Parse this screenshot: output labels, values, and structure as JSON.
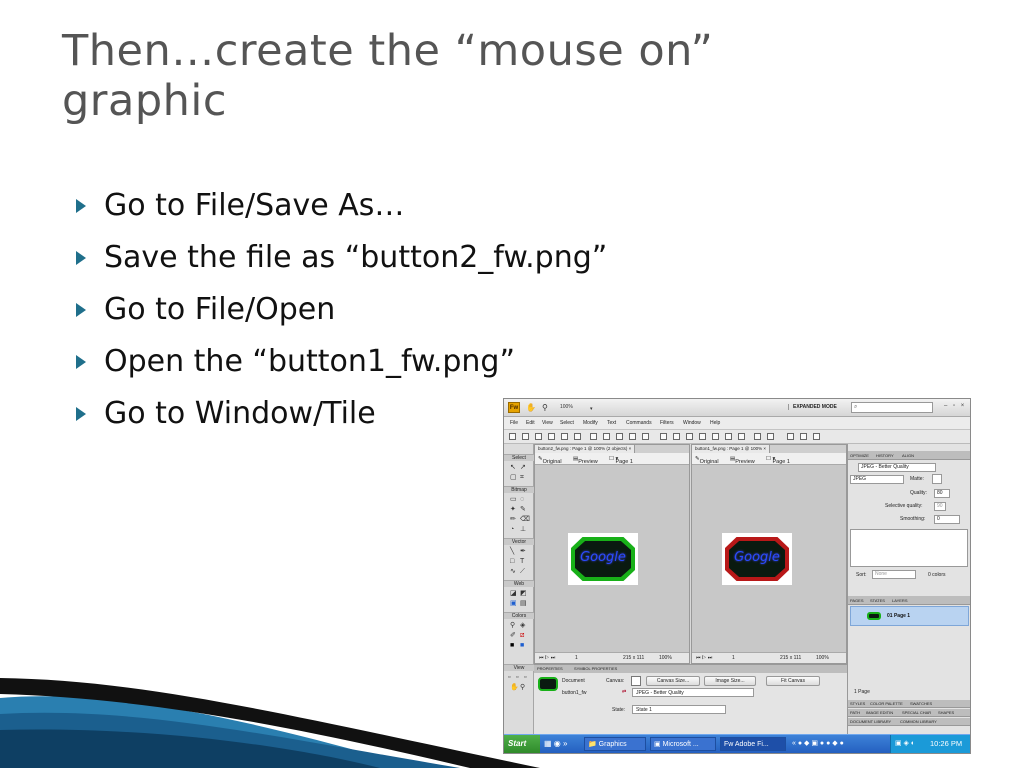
{
  "slide": {
    "title": "Then…create the “mouse on” graphic",
    "bullets": [
      "Go to File/Save As…",
      "Save the file as “button2_fw.png”",
      "Go to File/Open",
      "Open the “button1_fw.png”",
      "Go to Window/Tile"
    ]
  },
  "screenshot": {
    "app_logo": "Fw",
    "zoom": "100%",
    "mode": "EXPANDED MODE",
    "window_controls": "– ▫ ×",
    "menu": [
      "File",
      "Edit",
      "View",
      "Select",
      "Modify",
      "Text",
      "Commands",
      "Filters",
      "Window",
      "Help"
    ],
    "tools": {
      "groups": [
        "Select",
        "Bitmap",
        "Vector",
        "Web",
        "Colors",
        "View"
      ]
    },
    "documents": [
      {
        "tab": "button2_fw.png : Page 1 @ 100% (2 objects)  ×",
        "view_original": "Original",
        "view_preview": "Preview",
        "page": "Page 1",
        "image_text": "Google",
        "size": "215 x 111",
        "zoom": "100%",
        "frame": "1"
      },
      {
        "tab": "button1_fw.png : Page 1 @ 100%  ×",
        "view_original": "Original",
        "view_preview": "Preview",
        "page": "Page 1",
        "image_text": "Google",
        "size": "215 x 111",
        "zoom": "100%",
        "frame": "1"
      }
    ],
    "properties": {
      "tabs": [
        "PROPERTIES",
        "SYMBOL PROPERTIES"
      ],
      "doc_label": "Document",
      "doc_name": "button1_fw",
      "canvas_label": "Canvas:",
      "canvas_size_btn": "Canvas Size...",
      "image_size_btn": "Image Size...",
      "fit_canvas_btn": "Fit Canvas",
      "format": "JPEG - Better Quality",
      "state_label": "State:",
      "state_value": "State 1"
    },
    "optimize": {
      "tabs": [
        "OPTIMIZE",
        "HISTORY",
        "ALIGN"
      ],
      "preset": "JPEG - Better Quality",
      "format": "JPEG",
      "matte_label": "Matte:",
      "quality_label": "Quality:",
      "quality_value": "80",
      "selective_label": "Selective quality:",
      "selective_value": "90",
      "smoothing_label": "Smoothing:",
      "smoothing_value": "0",
      "sort_label": "Sort:",
      "sort_value": "None",
      "colors": "0 colors"
    },
    "pages": {
      "tabs": [
        "PAGES",
        "STATES",
        "LAYERS"
      ],
      "page_item": "01  Page 1",
      "count": "1 Page"
    },
    "bottom_tabs": [
      [
        "STYLES",
        "COLOR PALETTE",
        "SWATCHES"
      ],
      [
        "PATH",
        "IMAGE EDITIN",
        "SPECIAL CHAR",
        "SHAPES"
      ],
      [
        "DOCUMENT LIBRARY",
        "COMMON LIBRARY"
      ]
    ],
    "taskbar": {
      "start": "Start",
      "tasks": [
        "Graphics",
        "Microsoft ...",
        "Adobe Fi..."
      ],
      "clock": "10:26 PM"
    }
  }
}
